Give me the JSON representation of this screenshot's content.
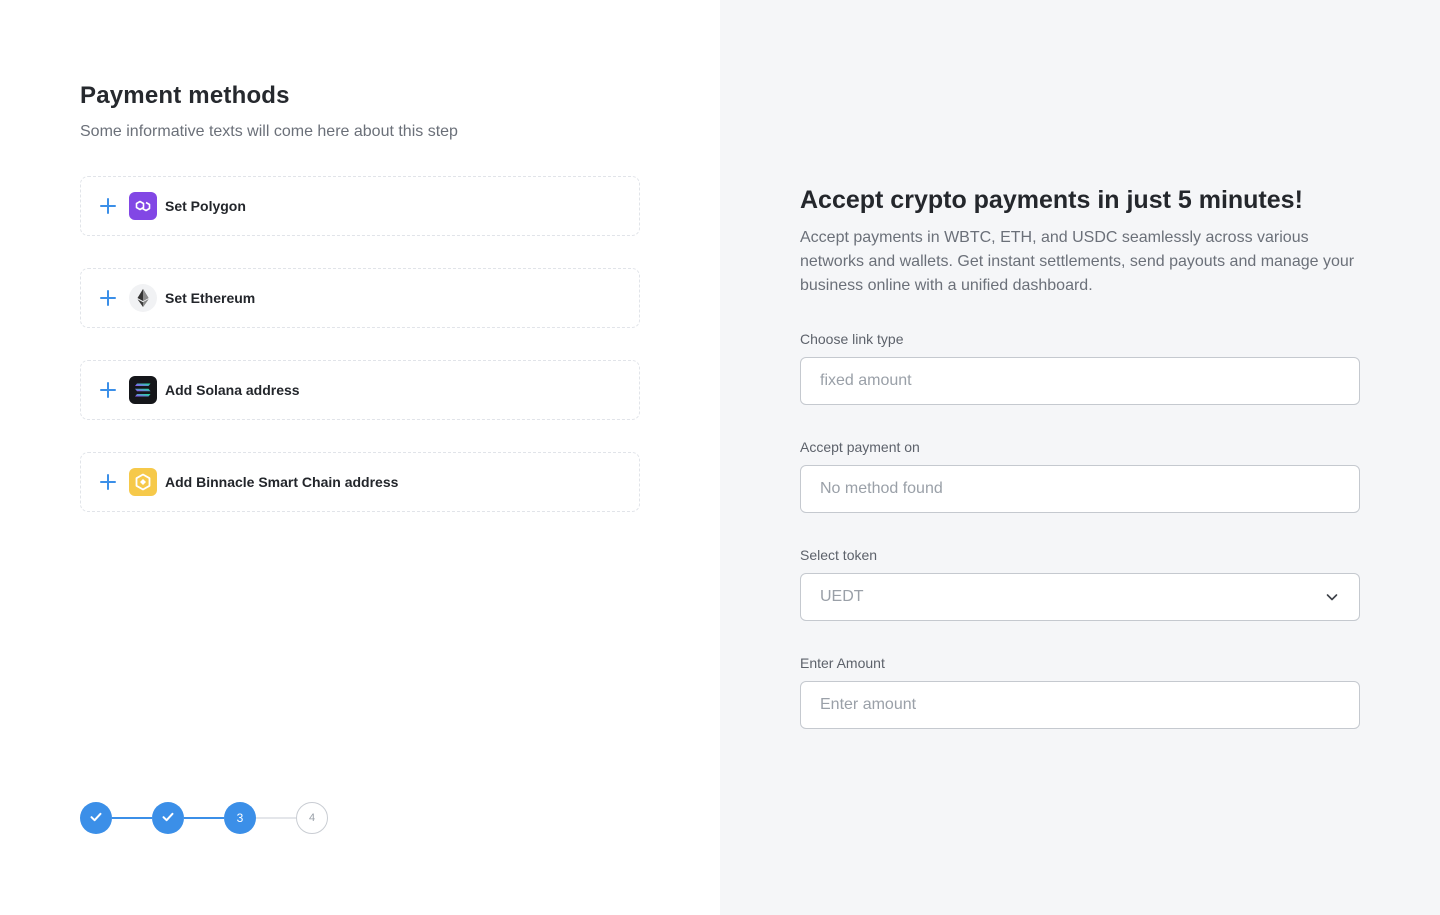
{
  "left_panel": {
    "title": "Payment methods",
    "subtitle": "Some informative texts will come here about this step",
    "methods": [
      {
        "label": "Set Polygon",
        "icon": "polygon-icon"
      },
      {
        "label": "Set Ethereum",
        "icon": "ethereum-icon"
      },
      {
        "label": "Add Solana address",
        "icon": "solana-icon"
      },
      {
        "label": "Add Binnacle Smart Chain address",
        "icon": "bnb-icon"
      }
    ],
    "stepper": {
      "steps": [
        {
          "state": "done",
          "label": ""
        },
        {
          "state": "done",
          "label": ""
        },
        {
          "state": "active",
          "label": "3"
        },
        {
          "state": "todo",
          "label": "4"
        }
      ],
      "current_step": 3,
      "total_steps": 4
    }
  },
  "right_panel": {
    "title": "Accept crypto payments in just 5 minutes!",
    "description": "Accept payments in WBTC, ETH, and USDC seamlessly across various networks and wallets. Get instant settlements, send payouts and manage your business online with a unified dashboard.",
    "fields": {
      "link_type": {
        "label": "Choose link type",
        "placeholder": "fixed amount"
      },
      "accept_on": {
        "label": "Accept payment on",
        "placeholder": "No method found"
      },
      "token": {
        "label": "Select token",
        "value": "UEDT"
      },
      "amount": {
        "label": "Enter Amount",
        "placeholder": "Enter amount"
      }
    }
  },
  "colors": {
    "accent": "#3b8fe8",
    "right_bg": "#f5f6f8",
    "polygon": "#8247e5",
    "bnb": "#f6c94a",
    "solana_bg": "#15161a"
  }
}
